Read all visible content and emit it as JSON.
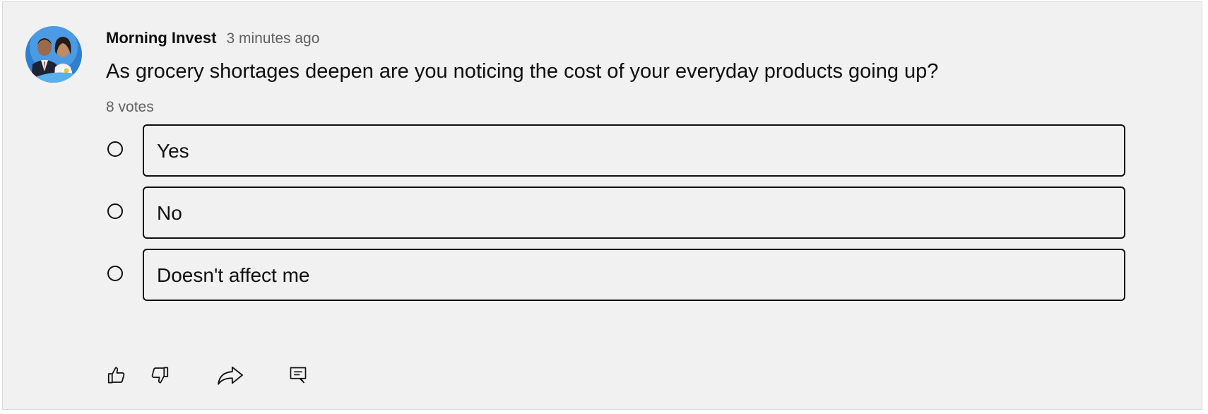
{
  "post": {
    "author": "Morning Invest",
    "time": "3 minutes ago",
    "question": "As grocery shortages deepen are you noticing the cost of your everyday products going up?",
    "votes": "8 votes"
  },
  "poll": {
    "options": [
      {
        "label": "Yes"
      },
      {
        "label": "No"
      },
      {
        "label": "Doesn't affect me"
      }
    ]
  },
  "actions": {
    "icons": [
      "thumbs-up-icon",
      "thumbs-down-icon",
      "share-icon",
      "comment-icon"
    ]
  },
  "colors": {
    "background": "#f1f1f1",
    "text": "#0f0f0f",
    "secondary_text": "#606060",
    "avatar_blue": "#3d8fd6"
  }
}
